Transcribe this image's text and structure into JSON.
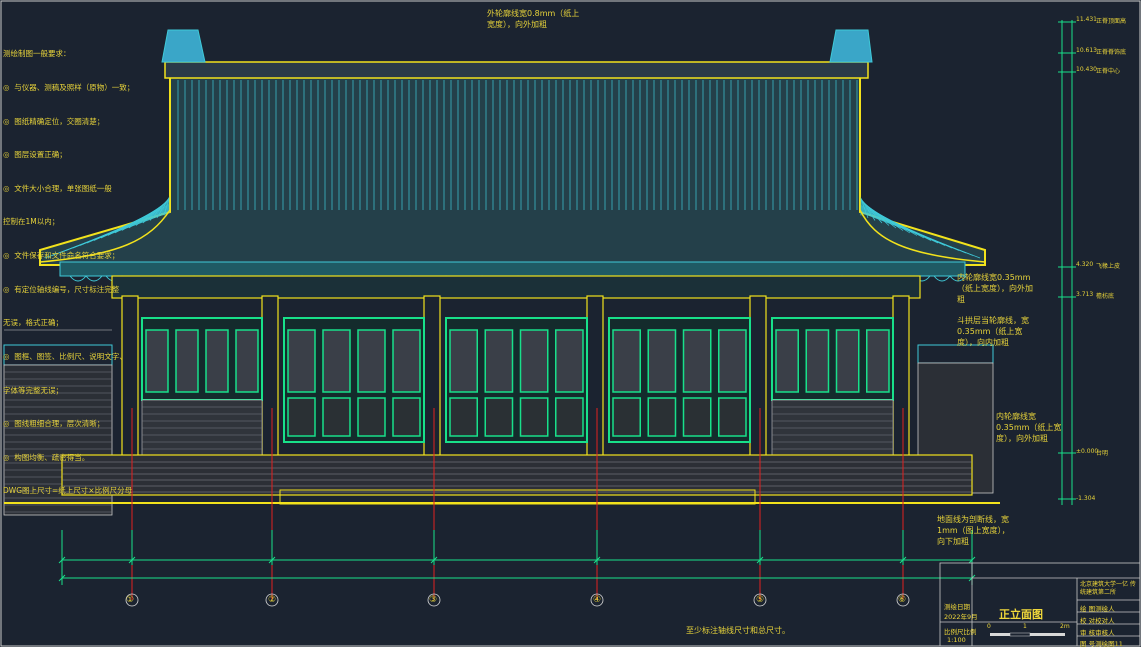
{
  "notes": {
    "title": "测绘制图一般要求：",
    "items": [
      "◎  与仪器、测稿及照样（原物）一致；",
      "◎  图纸精确定位，交圈清楚；",
      "◎  图层设置正确；",
      "◎  文件大小合理，单张图纸一般",
      "控制在1M以内；",
      "◎  文件保存和文件命名符合要求；",
      "◎  有定位轴线编号，尺寸标注完整",
      "无误，格式正确；",
      "◎  图框、图签、比例尺、说明文字、",
      "字体等完整无误；",
      "◎  图线粗细合理，层次清晰；",
      "◎  构图均衡、疏密得当。",
      "DWG图上尺寸=纸上尺寸×比例尺分母"
    ]
  },
  "annotations": {
    "outer_top": "外轮廓线宽0.8mm（纸上宽度），向外加粗",
    "inner_right_1": "内轮廓线宽0.35mm（纸上宽度），向外加粗",
    "dougong": "斗拱层当轮廓线，宽 0.35mm（纸上宽度），向内加粗",
    "inner_right_2": "内轮廓线宽0.35mm（纸上宽度），向外加粗",
    "ground": "地面线为剖断线，宽 1mm（图上宽度），向下加粗",
    "bottom": "至少标注轴线尺寸和总尺寸。"
  },
  "levels": [
    {
      "value": "11.431",
      "label": "正脊顶面高"
    },
    {
      "value": "10.613",
      "label": "正脊脊饰底"
    },
    {
      "value": "10.430",
      "label": "正脊中心"
    },
    {
      "value": "4.320",
      "label": "飞椽上皮"
    },
    {
      "value": "3.713",
      "label": "檐枋底"
    },
    {
      "value": "±0.000",
      "label": "台明"
    },
    {
      "value": "-1.304",
      "label": ""
    }
  ],
  "axes": [
    "①",
    "②",
    "③",
    "④",
    "⑤",
    "⑥"
  ],
  "title_block": {
    "drawing_title": "正立面图",
    "date_label": "测绘日期",
    "date_value": "2022年9月",
    "scale_label": "比例尺比例",
    "scale_value": "1:100",
    "scale_bar": [
      "0",
      "1",
      "2m"
    ],
    "org": "北京建筑大学一亿 传统建筑第二所",
    "rows": [
      "绘 图测绘人",
      "校 对校对人",
      "审 核审核人",
      "图 号测绘图11"
    ]
  },
  "colors": {
    "background": "#1b2330",
    "yellow": "#f2e21c",
    "cyan": "#3fc9d8",
    "green": "#18e08a",
    "red": "#e02020",
    "white": "#d8d8d8",
    "magenta": "#b63cc8"
  }
}
